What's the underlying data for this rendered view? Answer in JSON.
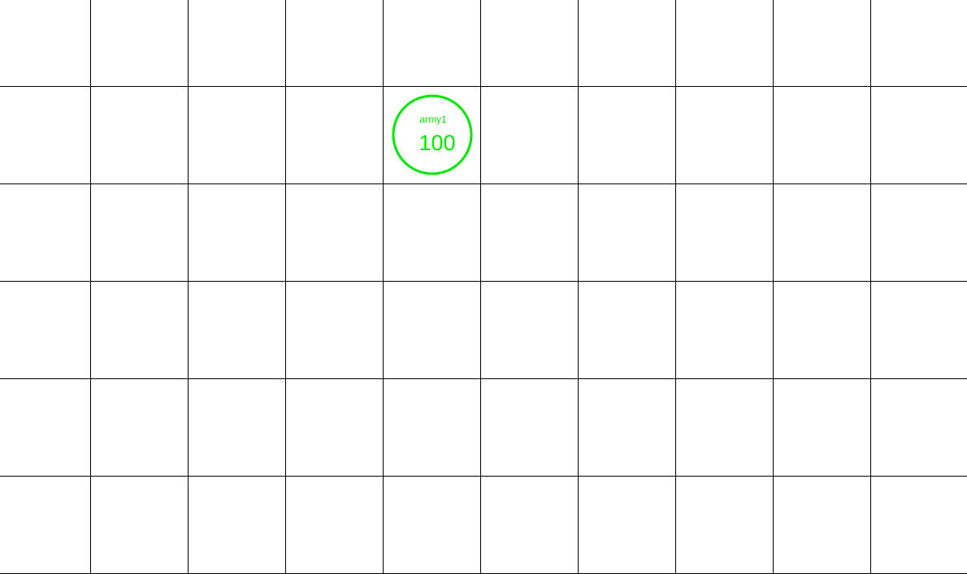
{
  "board": {
    "columns": 10,
    "rows": 6,
    "line_color": "#000000",
    "background": "#ffffff"
  },
  "units": [
    {
      "name": "army1",
      "strength": "100",
      "color": "#00e600",
      "column": 4,
      "row": 1
    }
  ]
}
